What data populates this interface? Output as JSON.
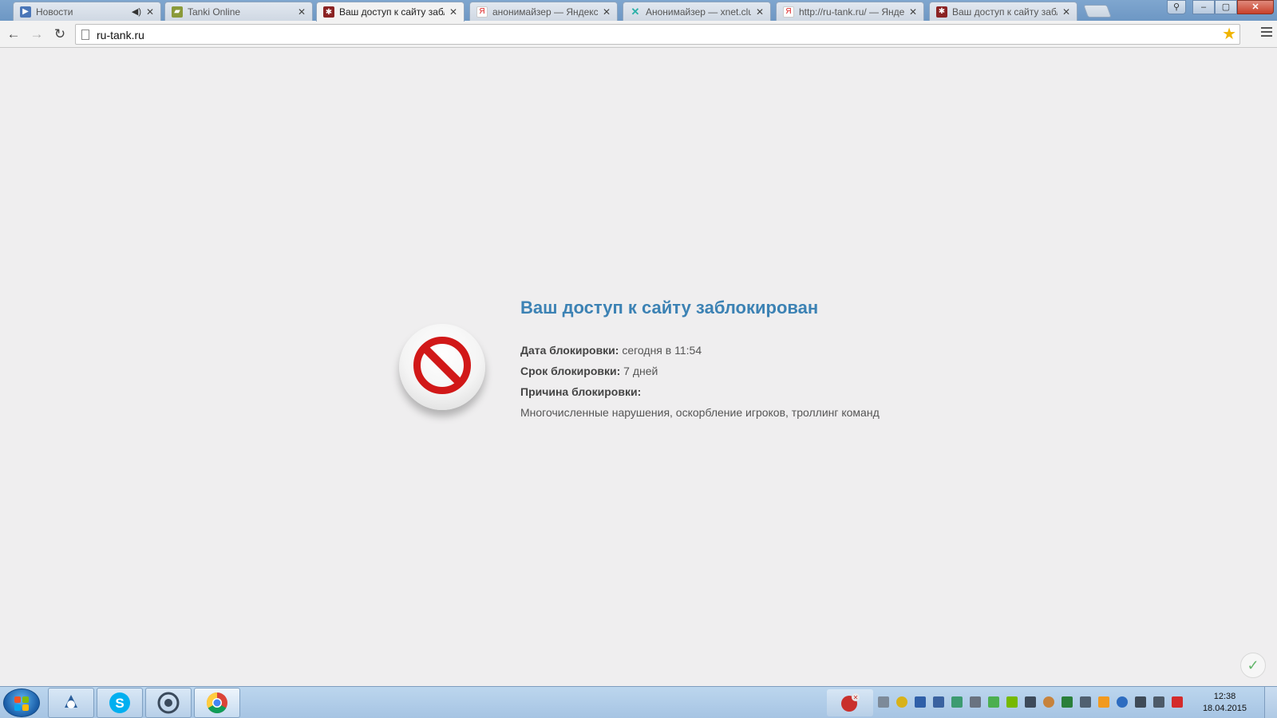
{
  "browser": {
    "tabs": [
      {
        "label": "Новости",
        "favicon": "play-icon",
        "muted": true,
        "active": false
      },
      {
        "label": "Tanki Online",
        "favicon": "tank-icon",
        "active": false
      },
      {
        "label": "Ваш доступ к сайту забло",
        "favicon": "site-icon",
        "active": true
      },
      {
        "label": "анонимайзер — Яндекс:",
        "favicon": "yandex-icon",
        "active": false
      },
      {
        "label": "Анонимайзер — xnet.clu",
        "favicon": "xnet-icon",
        "active": false
      },
      {
        "label": "http://ru-tank.ru/ — Янде",
        "favicon": "yandex-icon",
        "active": false
      },
      {
        "label": "Ваш доступ к сайту забло",
        "favicon": "site-icon",
        "active": false
      }
    ],
    "url": "ru-tank.ru"
  },
  "page": {
    "title": "Ваш доступ к сайту заблокирован",
    "date_label": "Дата блокировки:",
    "date_value": "сегодня в 11:54",
    "term_label": "Срок блокировки:",
    "term_value": "7 дней",
    "reason_label": "Причина блокировки:",
    "reason_value": "Многочисленные нарушения, оскорбление игроков, троллинг команд"
  },
  "taskbar": {
    "time": "12:38",
    "date": "18.04.2015"
  },
  "colors": {
    "title": "#3c82b4",
    "block_red": "#d11818"
  }
}
